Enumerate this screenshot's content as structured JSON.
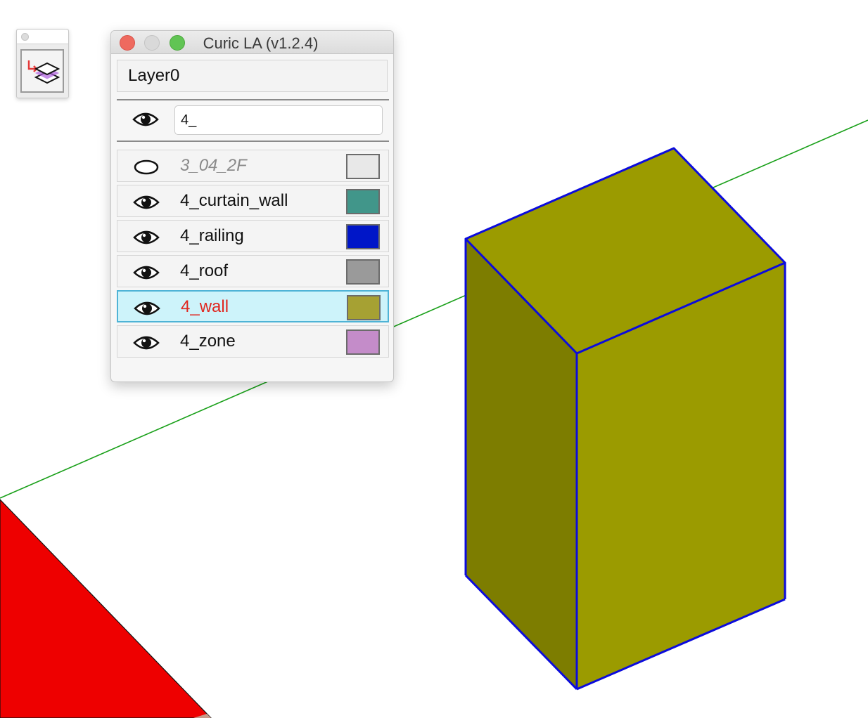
{
  "window": {
    "title": "Curic LA (v1.2.4)",
    "buttons": [
      "close",
      "minimize",
      "zoom"
    ]
  },
  "toolbar": {
    "icon": "layer-assign-icon"
  },
  "current_layer": "Layer0",
  "filter": {
    "value": "4_",
    "icon": "eye-icon"
  },
  "layers": [
    {
      "name": "3_04_2F",
      "visible": false,
      "color": "#e8e8e8",
      "selected": false
    },
    {
      "name": "4_curtain_wall",
      "visible": true,
      "color": "#41968a",
      "selected": false
    },
    {
      "name": "4_railing",
      "visible": true,
      "color": "#0016c8",
      "selected": false
    },
    {
      "name": "4_roof",
      "visible": true,
      "color": "#9a9a9a",
      "selected": false
    },
    {
      "name": "4_wall",
      "visible": true,
      "color": "#a6a133",
      "selected": true
    },
    {
      "name": "4_zone",
      "visible": true,
      "color": "#c48cc9",
      "selected": false
    }
  ],
  "scene": {
    "axis_color": "#19a019",
    "box_top_color": "#9b9b00",
    "box_left_color": "#7d7d00",
    "box_right_color": "#9b9b00",
    "box_edge_color": "#0b0bdc",
    "red_face_color": "#ee0000"
  }
}
